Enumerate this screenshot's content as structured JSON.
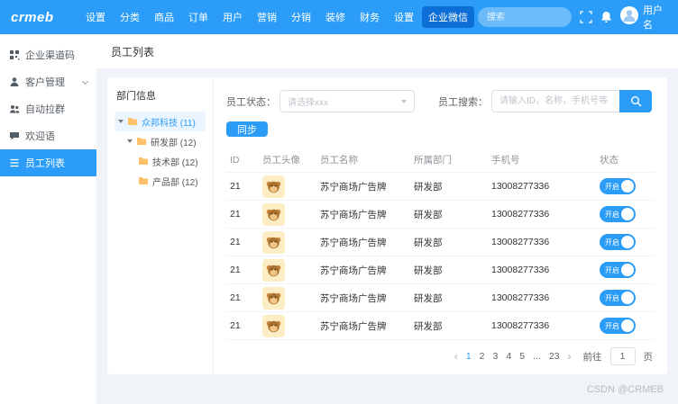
{
  "topbar": {
    "logo": "crmeb",
    "search_placeholder": "搜索",
    "username": "用户名",
    "nav": [
      {
        "label": "设置"
      },
      {
        "label": "分类"
      },
      {
        "label": "商品"
      },
      {
        "label": "订单"
      },
      {
        "label": "用户"
      },
      {
        "label": "营销"
      },
      {
        "label": "分销"
      },
      {
        "label": "装修"
      },
      {
        "label": "财务"
      },
      {
        "label": "设置"
      },
      {
        "label": "企业微信"
      }
    ]
  },
  "sidebar": {
    "items": [
      {
        "label": "企业渠道码"
      },
      {
        "label": "客户管理"
      },
      {
        "label": "自动拉群"
      },
      {
        "label": "欢迎语"
      },
      {
        "label": "员工列表"
      }
    ]
  },
  "breadcrumb": {
    "title": "员工列表"
  },
  "departments": {
    "title": "部门信息",
    "tree": [
      {
        "label": "众邦科技 (11)"
      },
      {
        "label": "研发部 (12)"
      },
      {
        "label": "技术部 (12)"
      },
      {
        "label": "产品部 (12)"
      }
    ]
  },
  "filters": {
    "status_label": "员工状态：",
    "status_placeholder": "请选择xxx",
    "search_label": "员工搜索：",
    "search_placeholder": "请输入ID，名称，手机号等",
    "sync_button": "同步"
  },
  "table": {
    "columns": {
      "id": "ID",
      "avatar": "员工头像",
      "name": "员工名称",
      "dept": "所属部门",
      "phone": "手机号",
      "status": "状态"
    },
    "rows": [
      {
        "id": "21",
        "name": "苏宁商场广告牌",
        "dept": "研发部",
        "phone": "13008277336",
        "status_label": "开启"
      },
      {
        "id": "21",
        "name": "苏宁商场广告牌",
        "dept": "研发部",
        "phone": "13008277336",
        "status_label": "开启"
      },
      {
        "id": "21",
        "name": "苏宁商场广告牌",
        "dept": "研发部",
        "phone": "13008277336",
        "status_label": "开启"
      },
      {
        "id": "21",
        "name": "苏宁商场广告牌",
        "dept": "研发部",
        "phone": "13008277336",
        "status_label": "开启"
      },
      {
        "id": "21",
        "name": "苏宁商场广告牌",
        "dept": "研发部",
        "phone": "13008277336",
        "status_label": "开启"
      },
      {
        "id": "21",
        "name": "苏宁商场广告牌",
        "dept": "研发部",
        "phone": "13008277336",
        "status_label": "开启"
      }
    ]
  },
  "pagination": {
    "prev": "‹",
    "next": "›",
    "pages": [
      "1",
      "2",
      "3",
      "4",
      "5",
      "...",
      "23"
    ],
    "goto_label": "前往",
    "goto_value": "1",
    "unit_label": "页"
  },
  "watermark": "CSDN @CRMEB",
  "colors": {
    "primary": "#2b9df8"
  }
}
